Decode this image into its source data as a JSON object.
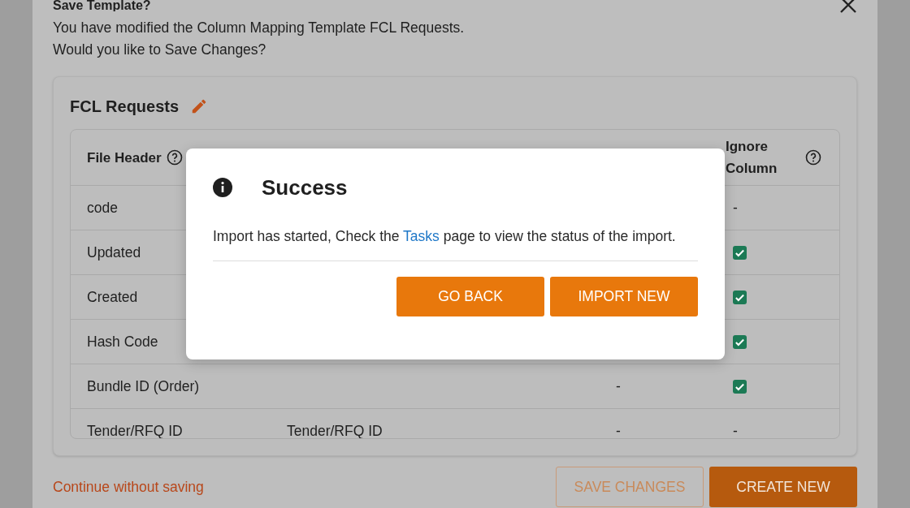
{
  "dialog": {
    "title": "Save Template?",
    "message_lines": [
      "You have modified the Column Mapping Template FCL Requests.",
      "Would you like to Save Changes?"
    ]
  },
  "template": {
    "name": "FCL Requests",
    "columns": [
      {
        "label": "File Header"
      },
      {
        "label": "Ignore Column"
      }
    ],
    "rows": [
      {
        "file_header": "code",
        "ignore": {
          "kind": "dash",
          "text": "-"
        }
      },
      {
        "file_header": "Updated",
        "ignore": {
          "kind": "checkbox",
          "checked": true
        }
      },
      {
        "file_header": "Created",
        "ignore": {
          "kind": "checkbox",
          "checked": true
        }
      },
      {
        "file_header": "Hash Code",
        "ignore": {
          "kind": "checkbox",
          "checked": true
        }
      },
      {
        "file_header": "Bundle ID (Order)",
        "unique": "-",
        "ignore": {
          "kind": "checkbox",
          "checked": true
        }
      },
      {
        "file_header": "Tender/RFQ ID",
        "mapping": "Tender/RFQ ID",
        "unique": "-",
        "ignore": {
          "kind": "dash",
          "text": "-"
        }
      }
    ]
  },
  "footer": {
    "link": "Continue without saving",
    "buttons": [
      {
        "label": "SAVE CHANGES",
        "kind": "outline"
      },
      {
        "label": "CREATE NEW",
        "kind": "filled"
      }
    ]
  },
  "popup": {
    "title": "Success",
    "message": {
      "before": "Import has started, Check the ",
      "link": "Tasks",
      "after": " page to view the status of the import."
    },
    "buttons": [
      {
        "label": "GO BACK"
      },
      {
        "label": "IMPORT NEW"
      }
    ]
  }
}
